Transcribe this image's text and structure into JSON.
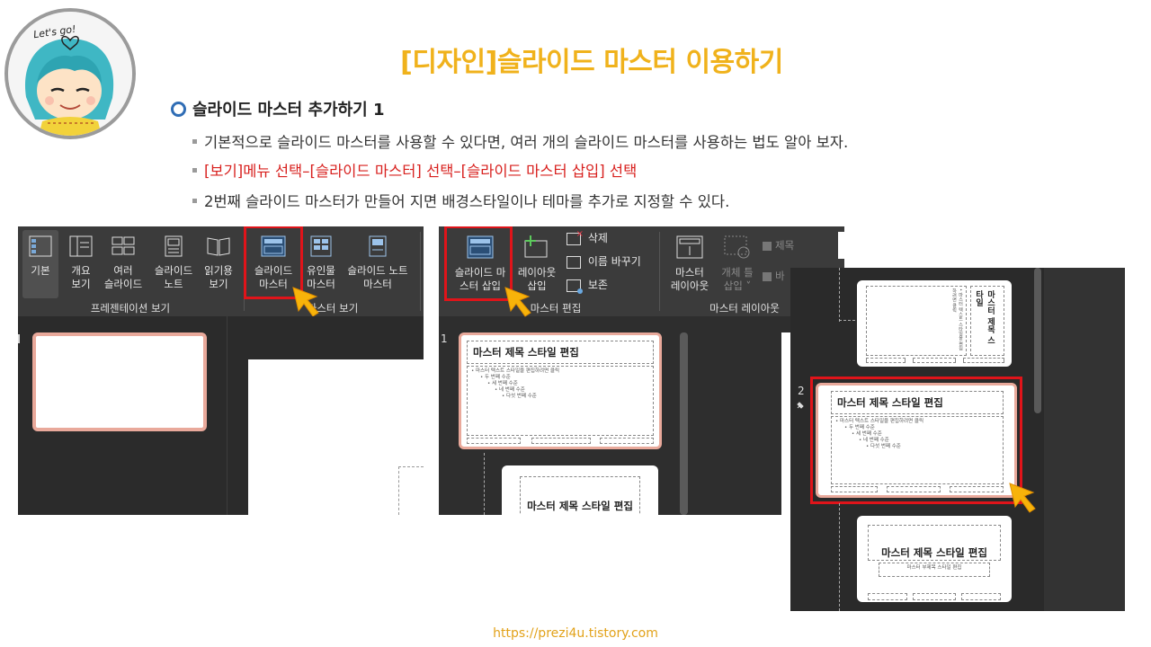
{
  "header": {
    "title": "[디자인]슬라이드 마스터 이용하기",
    "section": "슬라이드 마스터 추가하기 1",
    "bullets": [
      "기본적으로 슬라이드 마스터를 사용할 수 있다면, 여러 개의 슬라이드 마스터를 사용하는 법도 알아 보자.",
      "[보기]메뉴 선택–[슬라이드 마스터] 선택–[슬라이드 마스터 삽입] 선택",
      "2번째 슬라이드 마스터가 만들어 지면 배경스타일이나 테마를 추가로 지정할 수 있다."
    ]
  },
  "avatar": {
    "caption": "Let's go!"
  },
  "ribbon1": {
    "buttons": [
      {
        "l1": "기본",
        "l2": ""
      },
      {
        "l1": "개요",
        "l2": "보기"
      },
      {
        "l1": "여러",
        "l2": "슬라이드"
      },
      {
        "l1": "슬라이드",
        "l2": "노트"
      },
      {
        "l1": "읽기용",
        "l2": "보기"
      },
      {
        "l1": "슬라이드",
        "l2": "마스터"
      },
      {
        "l1": "유인물",
        "l2": "마스터"
      },
      {
        "l1": "슬라이드 노트",
        "l2": "마스터"
      }
    ],
    "group1": "프레젠테이션 보기",
    "group2": "마스터 보기"
  },
  "ribbon2": {
    "insert_master": {
      "l1": "슬라이드 마",
      "l2": "스터 삽입"
    },
    "insert_layout": {
      "l1": "레이아웃",
      "l2": "삽입"
    },
    "delete": "삭제",
    "rename": "이름 바꾸기",
    "preserve": "보존",
    "master_layout": {
      "l1": "마스터",
      "l2": "레이아웃"
    },
    "insert_placeholder": {
      "l1": "개체 틀",
      "l2": "삽입 ˅"
    },
    "chk_title": "제목",
    "chk_footer": "바",
    "group_edit": "마스터 편집",
    "group_layout": "마스터 레이아웃"
  },
  "thumbs": {
    "num1": "1",
    "num2": "2",
    "master_title": "마스터 제목 스타일 편집",
    "master_text": "• 마스터 텍스트 스타일을 편집하려면 클릭",
    "level2": "• 두 번째 수준",
    "level3": "• 세 번째 수준",
    "level4": "• 네 번째 수준",
    "level5": "• 다섯 번째 수준",
    "subtitle": "마스터 부제목 스타일 편집",
    "vertical_title": "마스터 제목 스타일"
  },
  "footer": "https://prezi4u.tistory.com",
  "colors": {
    "title": "#f0b21c",
    "accent_red": "#d8201e",
    "highlight": "#e0141a",
    "cursor": "#f7b30a"
  }
}
